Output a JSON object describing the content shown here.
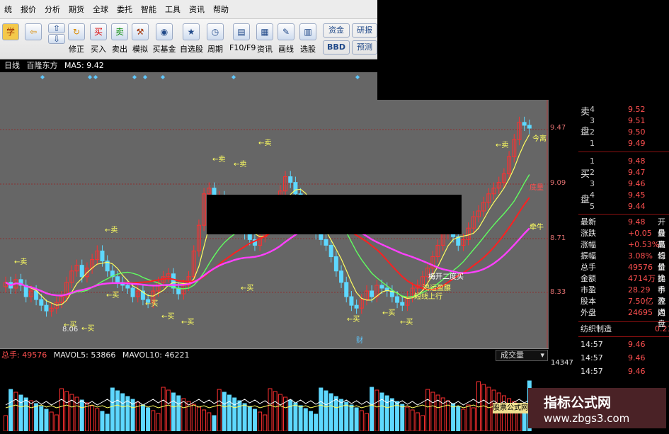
{
  "menu": [
    "统",
    "报价",
    "分析",
    "期货",
    "全球",
    "委托",
    "智能",
    "工具",
    "资讯",
    "帮助"
  ],
  "toolbar": [
    "修正",
    "买入",
    "卖出",
    "模拟",
    "买基金",
    "自选股",
    "周期",
    "F10/F9",
    "资讯",
    "画线",
    "选股",
    "资金",
    "研报",
    "BBD",
    "预测"
  ],
  "info": {
    "period": "日线",
    "name": "百隆东方",
    "ma": "MA5: 9.42"
  },
  "axis_prices": [
    "9.47",
    "9.09",
    "8.71",
    "8.33"
  ],
  "vol_axis": "14347",
  "low_label": "8.06",
  "fin_label": "财",
  "signals": {
    "buy": "买",
    "sell": "卖"
  },
  "chart_notes": [
    "今离",
    "底量",
    "牵牛",
    "梅开二度买",
    "短线上行",
    "鸿运盈腰"
  ],
  "volume_header": {
    "total": "总手: 49576",
    "mavol5": "MAVOL5: 53866",
    "mavol10": "MAVOL10: 46221",
    "dropdown": "成交量"
  },
  "order_book": {
    "sell_label": [
      "卖",
      "盘"
    ],
    "sell": [
      [
        "4",
        "9.52"
      ],
      [
        "3",
        "9.51"
      ],
      [
        "2",
        "9.50"
      ],
      [
        "1",
        "9.49"
      ]
    ],
    "buy_label": [
      "买",
      "盘"
    ],
    "buy": [
      [
        "1",
        "9.48"
      ],
      [
        "2",
        "9.47"
      ],
      [
        "3",
        "9.46"
      ],
      [
        "4",
        "9.45"
      ],
      [
        "5",
        "9.44"
      ]
    ]
  },
  "quote": [
    {
      "k": "最新",
      "v": "9.48",
      "r": "开盘"
    },
    {
      "k": "涨跌",
      "v": "+0.05",
      "r": "最高"
    },
    {
      "k": "涨幅",
      "v": "+0.53%",
      "r": "最低"
    },
    {
      "k": "振幅",
      "v": "3.08%",
      "r": "均价"
    },
    {
      "k": "总手",
      "v": "49576",
      "r": "量比"
    },
    {
      "k": "金额",
      "v": "4714万",
      "r": "换手"
    },
    {
      "k": "市盈",
      "v": "28.29",
      "r": "市盈"
    },
    {
      "k": "股本",
      "v": "7.50亿",
      "r": "流通"
    },
    {
      "k": "外盘",
      "v": "24695",
      "r": "内盘"
    }
  ],
  "industry": {
    "name": "纺织制造",
    "pct": "0.21%"
  },
  "ticks": [
    [
      "14:57",
      "9.46"
    ],
    [
      "14:57",
      "9.46"
    ],
    [
      "14:57",
      "9.46"
    ]
  ],
  "watermark": {
    "title": "指标公式网",
    "url": "www.zbgs3.com",
    "tag": "股票公式网"
  },
  "colors": {
    "up": "#ff3030",
    "down": "#5ed8ff",
    "ma_yellow": "#ffff60",
    "ma_red": "#ff2020",
    "ma_purple": "#ff40ff",
    "ma_green": "#60ff60"
  }
}
